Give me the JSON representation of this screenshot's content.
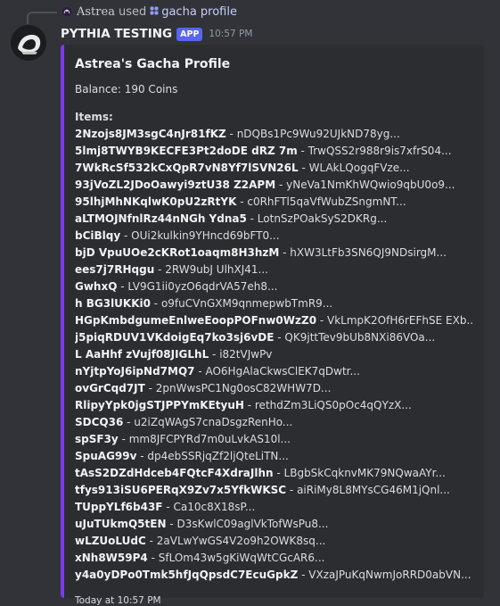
{
  "interaction": {
    "user": "Astrea",
    "used_text": "used",
    "command": "gacha profile"
  },
  "message": {
    "author": "PYTHIA TESTING",
    "badge": "APP",
    "timestamp": "10:57 PM"
  },
  "embed": {
    "title": "Astrea's Gacha Profile",
    "balance": "Balance: 190 Coins",
    "items_heading": "Items:",
    "items": [
      {
        "name": "2Nzojs8JM3sgC4nJr81fKZ",
        "value": "nDQBs1Pc9Wu92UJkND78yg..."
      },
      {
        "name": "5lmj8TWYB9KECFE3Pt2doDE dRZ 7m",
        "value": "TrwQSS2r988r9is7xfrS04..."
      },
      {
        "name": "7WkRcSf532kCxQpR7vN8Yf7lSVN26L",
        "value": "WLAkLQogqFVze..."
      },
      {
        "name": "93jVoZL2JDoOawyi9ztU38 Z2APM",
        "value": "yNeVa1NmKhWQwio9qbU0o9..."
      },
      {
        "name": "95lhjMhNKqlwK0pU2zRtYK",
        "value": "c0RhFTl5qaVfWubZSngmNT..."
      },
      {
        "name": "aLTMOJNfnlRz44nNGh Ydna5",
        "value": "LotnSzPOakSyS2DKRg..."
      },
      {
        "name": "bCiBlqy",
        "value": "OUi2kulkin9YHncd69bFT0..."
      },
      {
        "name": "bjD VpuUOe2cKRot1oaqm8H3hzM",
        "value": "hXW3LtFb3SN6QJ9NDsirgM..."
      },
      {
        "name": "ees7j7RHqgu",
        "value": "2RW9ubJ UlhXJ41..."
      },
      {
        "name": "GwhxQ",
        "value": "LV9G1ii0yzO6qdrVA57eh8..."
      },
      {
        "name": "h BG3lUKKi0",
        "value": "o9fuCVnGXM9qnmepwbTmR9..."
      },
      {
        "name": "HGpKmbdgumeEnlweEoopPOFnw0WzZ0",
        "value": "VkLmpK2OfH6rEFhSE EXb..."
      },
      {
        "name": "j5piqRDUV1VKdoigEq7ko3sj6vDE",
        "value": "QK9jttTev9bUb8NXi86VOa..."
      },
      {
        "name": "L AaHhf zVujf08JIGLhL",
        "value": "i82tVJwPv"
      },
      {
        "name": "nYjtpYoJ6ipNd7MQ7",
        "value": "AO6HgAlaCkwsClEK7qDwtr..."
      },
      {
        "name": "ovGrCqd7JT",
        "value": "2pnWwsPC1Ng0osC82WHW7D..."
      },
      {
        "name": "RlipyYpk0jgSTJPPYmKEtyuH",
        "value": "rethdZm3LiQS0pOc4qQYzX..."
      },
      {
        "name": "SDCQ36",
        "value": "u2iZqWAgS7cnaDsgzRenHo..."
      },
      {
        "name": "spSF3y",
        "value": "mm8JFCPYRd7m0uLvkAS10l..."
      },
      {
        "name": "SpuAG99v",
        "value": "dp4ebSSRjqZf2ljQteLiTN..."
      },
      {
        "name": "tAsS2DZdHdceb4FQtcF4XdraJlhn",
        "value": "LBgbSkCqknvMK79NQwaAYr..."
      },
      {
        "name": "tfys913iSU6PERqX9Zv7x5YfkWKSC",
        "value": "aiRiMy8L8MYsCG46M1jQnl..."
      },
      {
        "name": "TUppYLf6b43F",
        "value": "Ca10c8X18sP..."
      },
      {
        "name": "uJuTUkmQ5tEN",
        "value": "D3sKwlC09aglVkTofWsPu8..."
      },
      {
        "name": "wLZUoLUdC",
        "value": "2aVLwYwGS4V2o9h2OWK8sq..."
      },
      {
        "name": "xNh8W59P4",
        "value": "SfLOm43w5gKiWqWtCGcAR6..."
      },
      {
        "name": "y4a0yDPo0Tmk5hfJqQpsdC7EcuGpkZ",
        "value": "VXzaJPuKqNwmJoRRD0abVN..."
      }
    ],
    "separator": " - ",
    "footer": "Today at 10:57 PM"
  },
  "colors": {
    "background": "#313338",
    "embed_background": "#2b2d31",
    "embed_accent": "#7c3aed",
    "app_badge": "#5865f2",
    "command_link": "#c9cdfb"
  },
  "icons": {
    "mini_avatar": "pythia-logo-icon",
    "command": "slash-command-icon",
    "avatar": "bot-avatar-icon"
  }
}
